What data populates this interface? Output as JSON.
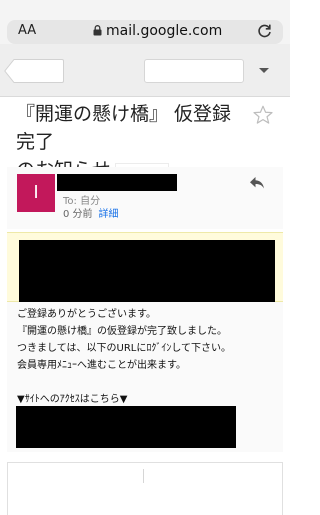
{
  "browser": {
    "text_size_label": "AA",
    "url": "mail.google.com",
    "colors": {
      "bar": "#f4f4f4",
      "field": "#e6e6e6"
    }
  },
  "email": {
    "subject_line1": "『開運の懸け橋』 仮登録完了",
    "subject_line2": "のお知らせ",
    "sender": {
      "avatar_letter": "I",
      "to_label": "To: 自分",
      "time": "0 分前",
      "details_link": "詳細",
      "avatar_color": "#c2185b"
    },
    "body_lines": [
      "ご登録ありがとうございます。",
      "『開運の懸け橋』の仮登録が完了致しました。",
      "つきましては、以下のURLにﾛｸﾞｲﾝして下さい。",
      "会員専用ﾒﾆｭｰへ進むことが出来ます。",
      "",
      "▼ｻｲﾄへのｱｸｾｽはこちら▼"
    ]
  }
}
